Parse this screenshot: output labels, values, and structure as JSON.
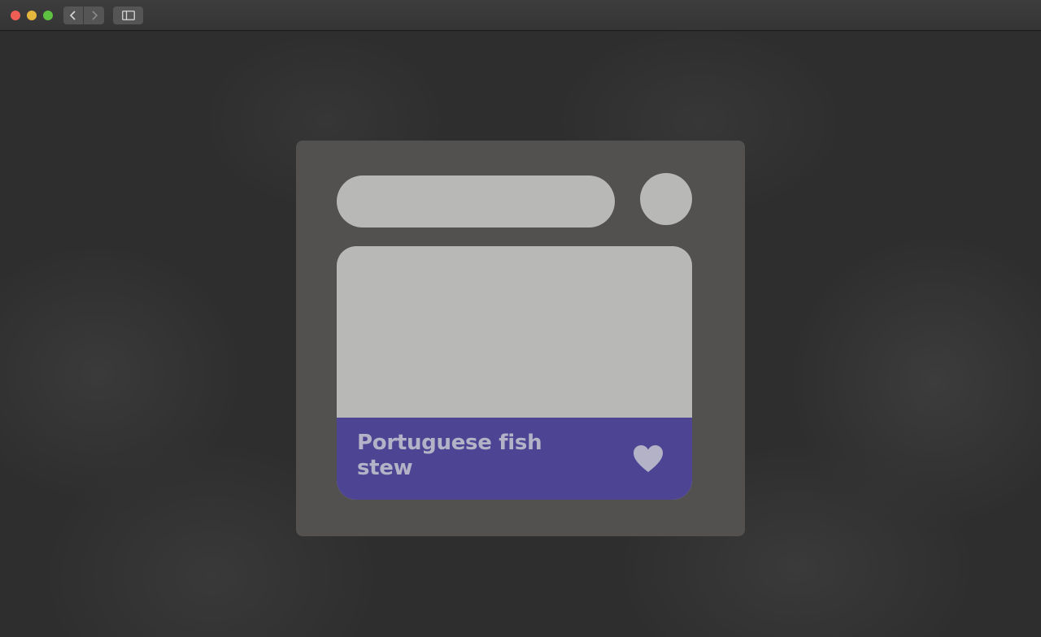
{
  "window": {
    "controls": [
      "close",
      "minimize",
      "maximize"
    ],
    "icons": {
      "back": "chevron-left-icon",
      "forward": "chevron-right-icon",
      "sidebar": "sidebar-icon"
    }
  },
  "recipe_card": {
    "title": "Portuguese fish stew",
    "favorite_icon": "heart-icon",
    "footer_color": "#4d4593"
  },
  "colors": {
    "skeleton": "#b8b8b7",
    "panel": "#525150",
    "background": "#2e2e2e"
  }
}
